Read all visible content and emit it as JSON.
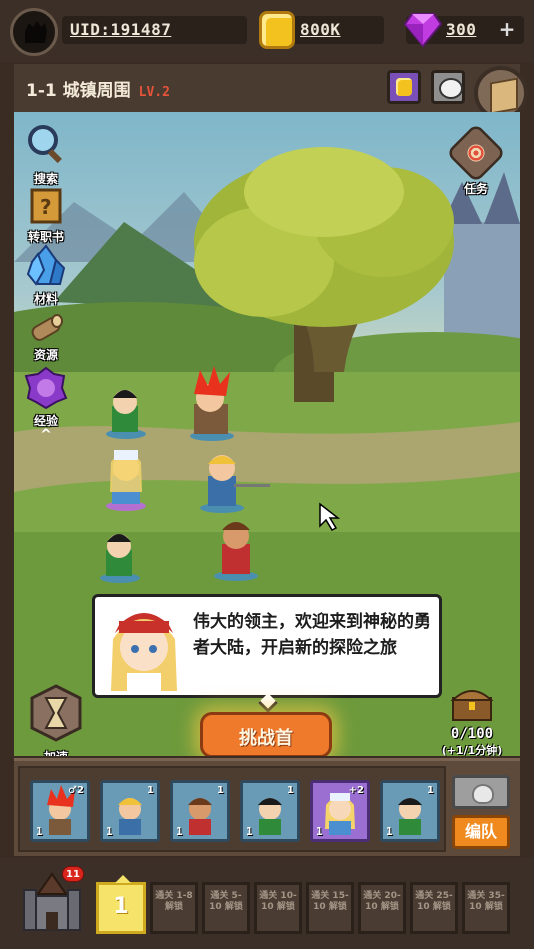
{
  "top": {
    "uid": "UID:191487",
    "gold": "800K",
    "gems": "300",
    "plus": "+"
  },
  "stage": {
    "name": "1-1 城镇周围",
    "level": "LV.2"
  },
  "side_menu": [
    {
      "label": "搜索",
      "icon": "magnifier-icon"
    },
    {
      "label": "转职书",
      "icon": "job-book-icon"
    },
    {
      "label": "材料",
      "icon": "crystal-icon"
    },
    {
      "label": "资源",
      "icon": "wood-log-icon"
    },
    {
      "label": "经验",
      "icon": "exp-orb-icon"
    }
  ],
  "quest": {
    "label": "任务"
  },
  "dialog": {
    "text": "伟大的领主，欢迎来到神秘的勇者大陆，开启新的探险之旅"
  },
  "speed": {
    "label": "加速"
  },
  "challenge": {
    "label": "挑战首"
  },
  "chest": {
    "count": "0/100",
    "rate": "(+1/1分钟)"
  },
  "team": {
    "slots": [
      {
        "level": "1",
        "tag": "♂2",
        "hero": "red-hair-warrior",
        "color": "blue"
      },
      {
        "level": "1",
        "tag": "1",
        "hero": "blonde-farmer",
        "color": "blue"
      },
      {
        "level": "1",
        "tag": "1",
        "hero": "monkey-fighter",
        "color": "blue"
      },
      {
        "level": "1",
        "tag": "1",
        "hero": "green-villager",
        "color": "blue"
      },
      {
        "level": "1",
        "tag": "+2",
        "hero": "blonde-priest",
        "color": "purple"
      },
      {
        "level": "1",
        "tag": "1",
        "hero": "green-villager",
        "color": "blue"
      }
    ],
    "team_button": "编队"
  },
  "bottom": {
    "badge": "11",
    "current_level": "1",
    "locked": [
      "通关 1-8 解锁",
      "通关 5-10 解锁",
      "通关 10-10 解锁",
      "通关 15-10 解锁",
      "通关 20-10 解锁",
      "通关 25-10 解锁",
      "通关 35-10 解锁"
    ]
  }
}
